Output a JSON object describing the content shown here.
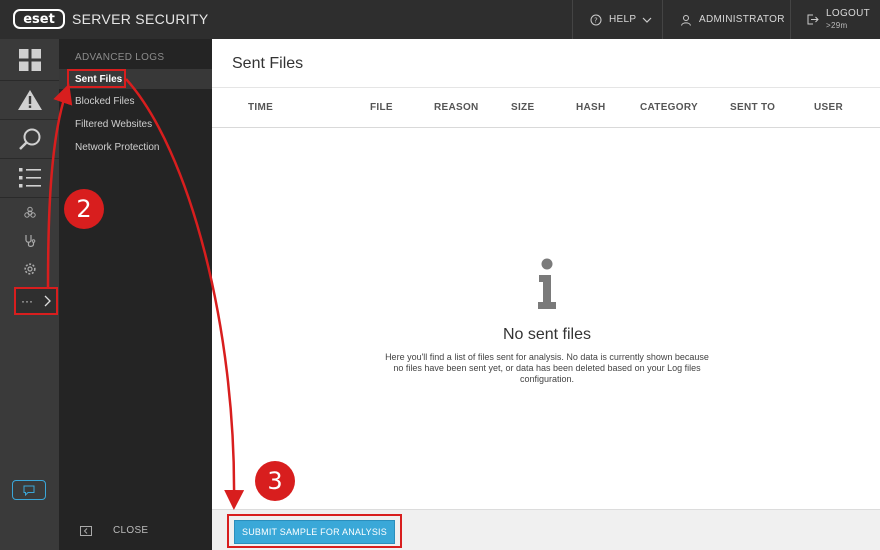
{
  "header": {
    "logo_text": "eset",
    "product": "SERVER SECURITY",
    "help_label": "HELP",
    "user_label": "ADMINISTRATOR",
    "logout_label": "LOGOUT",
    "logout_timer": ">29m"
  },
  "rail": {
    "icons": [
      "dashboard-icon",
      "alert-icon",
      "scan-icon",
      "list-icon",
      "biohazard-icon",
      "stethoscope-icon",
      "gear-icon"
    ],
    "more_label": "···"
  },
  "submenu": {
    "title": "ADVANCED LOGS",
    "items": [
      {
        "label": "Sent Files",
        "active": true
      },
      {
        "label": "Blocked Files",
        "active": false
      },
      {
        "label": "Filtered Websites",
        "active": false
      },
      {
        "label": "Network Protection",
        "active": false
      }
    ],
    "close_label": "CLOSE"
  },
  "main": {
    "title": "Sent Files",
    "columns": [
      "TIME",
      "FILE",
      "REASON",
      "SIZE",
      "HASH",
      "CATEGORY",
      "SENT TO",
      "USER"
    ],
    "empty_title": "No sent files",
    "empty_text": "Here you'll find a list of files sent for analysis. No data is currently shown because no files have been sent yet, or data has been deleted based on your Log files configuration.",
    "submit_label": "SUBMIT SAMPLE FOR ANALYSIS"
  },
  "annotations": {
    "step2": "2",
    "step3": "3",
    "color": "#d81e1e"
  },
  "colors": {
    "accent": "#3aa8d8",
    "topbar": "#2e2e2e",
    "rail": "#3a3a3a",
    "submenu": "#242424"
  }
}
